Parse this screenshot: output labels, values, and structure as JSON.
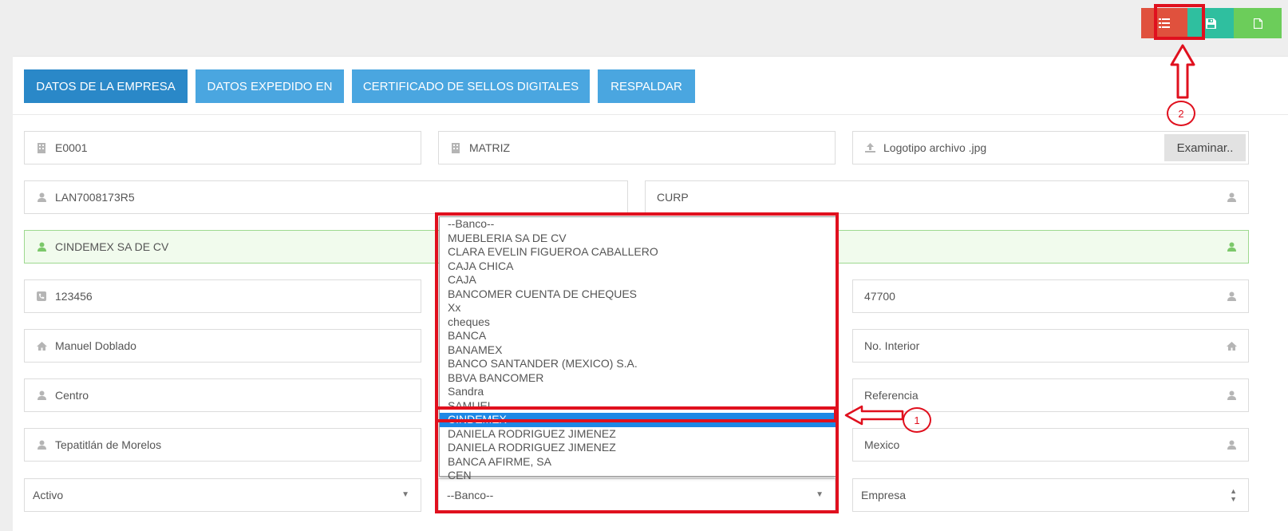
{
  "toolbar": {
    "list_icon": "list-icon",
    "save_icon": "save-icon",
    "new_icon": "file-icon"
  },
  "tabs": [
    {
      "label": "DATOS DE LA EMPRESA"
    },
    {
      "label": "DATOS EXPEDIDO EN"
    },
    {
      "label": "CERTIFICADO DE SELLOS DIGITALES"
    },
    {
      "label": "RESPALDAR"
    }
  ],
  "form": {
    "clave": "E0001",
    "sucursal": "MATRIZ",
    "logo_placeholder": "Logotipo archivo .jpg",
    "examinar": "Examinar..",
    "rfc": "LAN7008173R5",
    "curp_placeholder": "CURP",
    "razon_social": "CINDEMEX SA DE CV",
    "telefono": "123456",
    "cp": "47700",
    "calle": "Manuel Doblado",
    "no_interior_placeholder": "No. Interior",
    "colonia": "Centro",
    "referencia_placeholder": "Referencia",
    "municipio": "Tepatitlán de Morelos",
    "pais": "Mexico",
    "estado_select": "Activo",
    "banco_select": "--Banco--",
    "tipo_select": "Empresa"
  },
  "banco_options": [
    "--Banco--",
    "MUEBLERIA SA DE CV",
    "CLARA EVELIN FIGUEROA CABALLERO",
    "CAJA CHICA",
    "CAJA",
    "BANCOMER CUENTA DE CHEQUES",
    "Xx",
    "cheques",
    "BANCA",
    "BANAMEX",
    "BANCO SANTANDER (MEXICO) S.A.",
    "BBVA BANCOMER",
    "Sandra",
    "SAMUEL",
    "CINDEMEX",
    "DANIELA RODRIGUEZ JIMENEZ",
    "DANIELA RODRIGUEZ JIMENEZ",
    "BANCA AFIRME, SA",
    "CEN"
  ],
  "selected_option_index": 14,
  "annotations": {
    "step1": "1",
    "step2": "2",
    "color": "#e0101e"
  }
}
